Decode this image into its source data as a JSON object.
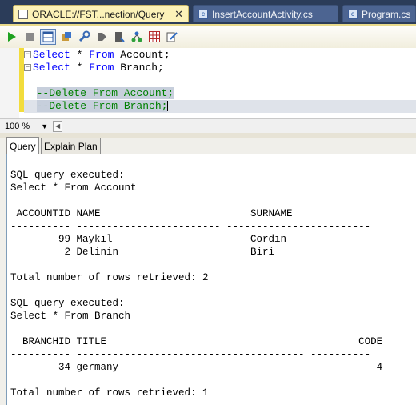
{
  "tabs": {
    "query_title": "ORACLE://FST...nection/Query",
    "insert_title": "InsertAccountActivity.cs",
    "program_title": "Program.cs",
    "close_glyph": "✕"
  },
  "editor": {
    "line1": {
      "kw1": "Select",
      "rest": " * ",
      "kw2": "From",
      "table": " Account;"
    },
    "line2": {
      "kw1": "Select",
      "rest": " * ",
      "kw2": "From",
      "table": " Branch;"
    },
    "line4": "--Delete From Account;",
    "line5": "--Delete From Branch;"
  },
  "zoom": {
    "value": "100 %"
  },
  "result_tabs": {
    "query": "Query",
    "explain": "Explain Plan"
  },
  "output": {
    "q1_exec": "SQL query executed:",
    "q1_sql": "Select * From Account",
    "q1_header": " ACCOUNTID NAME                         SURNAME",
    "q1_sep": "---------- ------------------------ ------------------------",
    "q1_rows": [
      "        99 Maykıl                       Cordın",
      "         2 Delinin                      Biri"
    ],
    "q1_total": "Total number of rows retrieved: 2",
    "q2_exec": "SQL query executed:",
    "q2_sql": "Select * From Branch",
    "q2_header": "  BRANCHID TITLE                                          CODE",
    "q2_sep": "---------- -------------------------------------- ----------",
    "q2_rows": [
      "        34 germany                                           4"
    ],
    "q2_total": "Total number of rows retrieved: 1"
  },
  "colors": {
    "tab_active": "#fcf2b8",
    "tab_inactive": "#4c6491",
    "window_bg": "#2b3c59",
    "keyword": "#0000ff",
    "comment": "#008000"
  },
  "icons": [
    "run-icon",
    "stop-icon",
    "results-grid-icon",
    "object-icon",
    "wrench-icon",
    "arrow-icon",
    "document-icon",
    "tree-icon",
    "grid-icon",
    "edit-icon"
  ]
}
